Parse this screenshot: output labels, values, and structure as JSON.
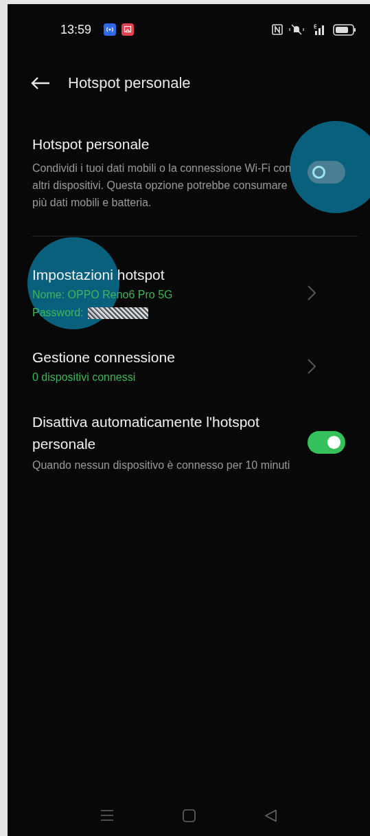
{
  "status_bar": {
    "time": "13:59"
  },
  "header": {
    "title": "Hotspot personale"
  },
  "main_toggle": {
    "title": "Hotspot personale",
    "description": "Condividi i tuoi dati mobili o la connessione Wi-Fi con altri dispositivi. Questa opzione potrebbe consumare più dati mobili e batteria.",
    "on": false
  },
  "items": [
    {
      "kind": "link",
      "title": "Impostazioni hotspot",
      "lines": [
        {
          "kind": "text",
          "text": "Nome: OPPO Reno6 Pro 5G"
        },
        {
          "kind": "secret",
          "text": "Password:"
        }
      ]
    },
    {
      "kind": "link",
      "title": "Gestione connessione",
      "lines": [
        {
          "kind": "text",
          "text": "0 dispositivi connessi"
        }
      ]
    },
    {
      "kind": "toggle",
      "title": "Disattiva automaticamente l'hotspot personale",
      "description": "Quando nessun dispositivo è connesso per 10 minuti",
      "on": true
    }
  ]
}
